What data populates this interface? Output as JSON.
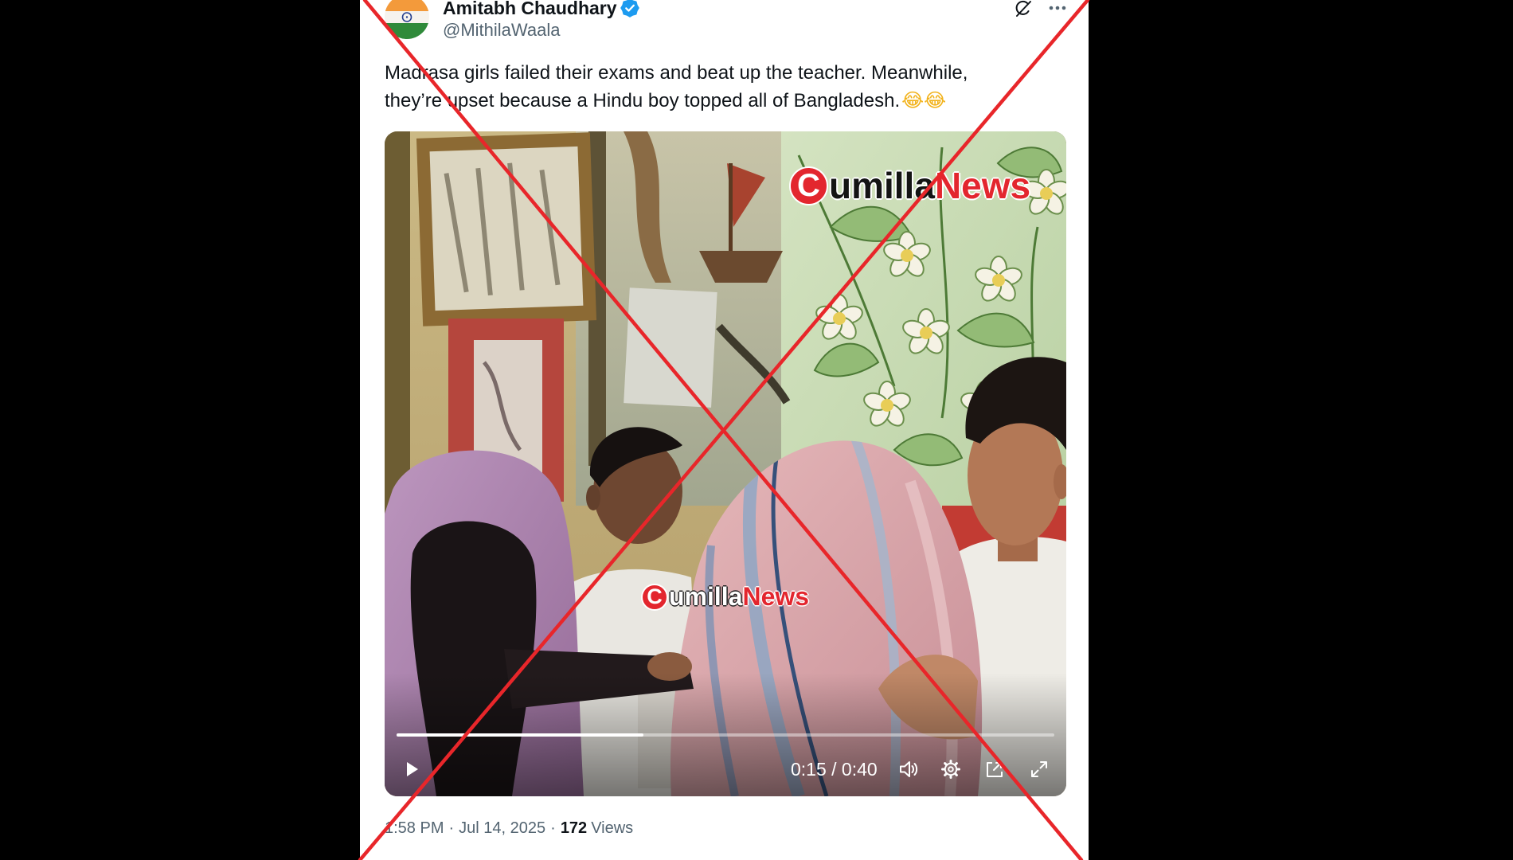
{
  "colors": {
    "page_bg": "#000000",
    "card_bg": "#ffffff",
    "text": "#0f1419",
    "muted": "#536471",
    "verified": "#1d9bf0",
    "overlay_x": "#e8262a",
    "watermark_red": "#e3262e"
  },
  "tweet": {
    "author": {
      "name": "Amitabh Chaudhary",
      "handle": "@MithilaWaala",
      "verified": true,
      "avatar_icon": "india-flag-avatar",
      "verified_icon": "verified-badge-icon"
    },
    "actions": {
      "grok_icon": "grok-icon",
      "more_icon": "more-options-icon"
    },
    "text_lines": [
      "Madrasa girls failed their exams and beat up the teacher. Meanwhile,",
      "they’re upset because a Hindu boy topped all of Bangladesh."
    ],
    "emoji": "😂😂",
    "video": {
      "watermark": {
        "letter": "C",
        "middle": "umilla",
        "suffix": "News"
      },
      "time_display": "0:15 / 0:40",
      "progress": 0.375,
      "controls": {
        "play": "play-icon",
        "volume": "volume-icon",
        "settings": "settings-icon",
        "popout": "popout-icon",
        "fullscreen": "fullscreen-icon"
      }
    },
    "meta": {
      "time": "1:58 PM",
      "separator": "·",
      "date": "Jul 14, 2025",
      "views_count": "172",
      "views_label": "Views"
    }
  },
  "overlay": {
    "mark_icon": "red-x-mark"
  }
}
